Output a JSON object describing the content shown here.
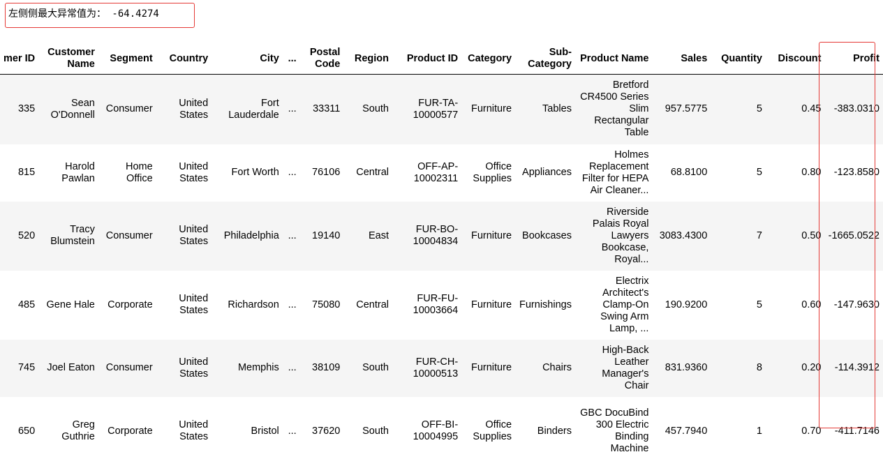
{
  "note": {
    "text": "左侧侧最大异常值为： -64.4274"
  },
  "table": {
    "headers": {
      "customer_id": "mer ID",
      "customer_name": "Customer Name",
      "segment": "Segment",
      "country": "Country",
      "city": "City",
      "ellipsis": "...",
      "postal_code": "Postal Code",
      "region": "Region",
      "product_id": "Product ID",
      "category": "Category",
      "sub_category": "Sub-Category",
      "product_name": "Product Name",
      "sales": "Sales",
      "quantity": "Quantity",
      "discount": "Discount",
      "profit": "Profit"
    },
    "rows": [
      {
        "customer_id": "335",
        "customer_name": "Sean O'Donnell",
        "segment": "Consumer",
        "country": "United States",
        "city": "Fort Lauderdale",
        "ellipsis": "...",
        "postal_code": "33311",
        "region": "South",
        "product_id": "FUR-TA-10000577",
        "category": "Furniture",
        "sub_category": "Tables",
        "product_name": "Bretford CR4500 Series Slim Rectangular Table",
        "sales": "957.5775",
        "quantity": "5",
        "discount": "0.45",
        "profit": "-383.0310"
      },
      {
        "customer_id": "815",
        "customer_name": "Harold Pawlan",
        "segment": "Home Office",
        "country": "United States",
        "city": "Fort Worth",
        "ellipsis": "...",
        "postal_code": "76106",
        "region": "Central",
        "product_id": "OFF-AP-10002311",
        "category": "Office Supplies",
        "sub_category": "Appliances",
        "product_name": "Holmes Replacement Filter for HEPA Air Cleaner...",
        "sales": "68.8100",
        "quantity": "5",
        "discount": "0.80",
        "profit": "-123.8580"
      },
      {
        "customer_id": "520",
        "customer_name": "Tracy Blumstein",
        "segment": "Consumer",
        "country": "United States",
        "city": "Philadelphia",
        "ellipsis": "...",
        "postal_code": "19140",
        "region": "East",
        "product_id": "FUR-BO-10004834",
        "category": "Furniture",
        "sub_category": "Bookcases",
        "product_name": "Riverside Palais Royal Lawyers Bookcase, Royal...",
        "sales": "3083.4300",
        "quantity": "7",
        "discount": "0.50",
        "profit": "-1665.0522"
      },
      {
        "customer_id": "485",
        "customer_name": "Gene Hale",
        "segment": "Corporate",
        "country": "United States",
        "city": "Richardson",
        "ellipsis": "...",
        "postal_code": "75080",
        "region": "Central",
        "product_id": "FUR-FU-10003664",
        "category": "Furniture",
        "sub_category": "Furnishings",
        "product_name": "Electrix Architect's Clamp-On Swing Arm Lamp, ...",
        "sales": "190.9200",
        "quantity": "5",
        "discount": "0.60",
        "profit": "-147.9630"
      },
      {
        "customer_id": "745",
        "customer_name": "Joel Eaton",
        "segment": "Consumer",
        "country": "United States",
        "city": "Memphis",
        "ellipsis": "...",
        "postal_code": "38109",
        "region": "South",
        "product_id": "FUR-CH-10000513",
        "category": "Furniture",
        "sub_category": "Chairs",
        "product_name": "High-Back Leather Manager's Chair",
        "sales": "831.9360",
        "quantity": "8",
        "discount": "0.20",
        "profit": "-114.3912"
      },
      {
        "customer_id": "650",
        "customer_name": "Greg Guthrie",
        "segment": "Corporate",
        "country": "United States",
        "city": "Bristol",
        "ellipsis": "...",
        "postal_code": "37620",
        "region": "South",
        "product_id": "OFF-BI-10004995",
        "category": "Office Supplies",
        "sub_category": "Binders",
        "product_name": "GBC DocuBind 300 Electric Binding Machine",
        "sales": "457.7940",
        "quantity": "1",
        "discount": "0.70",
        "profit": "-411.7146"
      }
    ]
  }
}
